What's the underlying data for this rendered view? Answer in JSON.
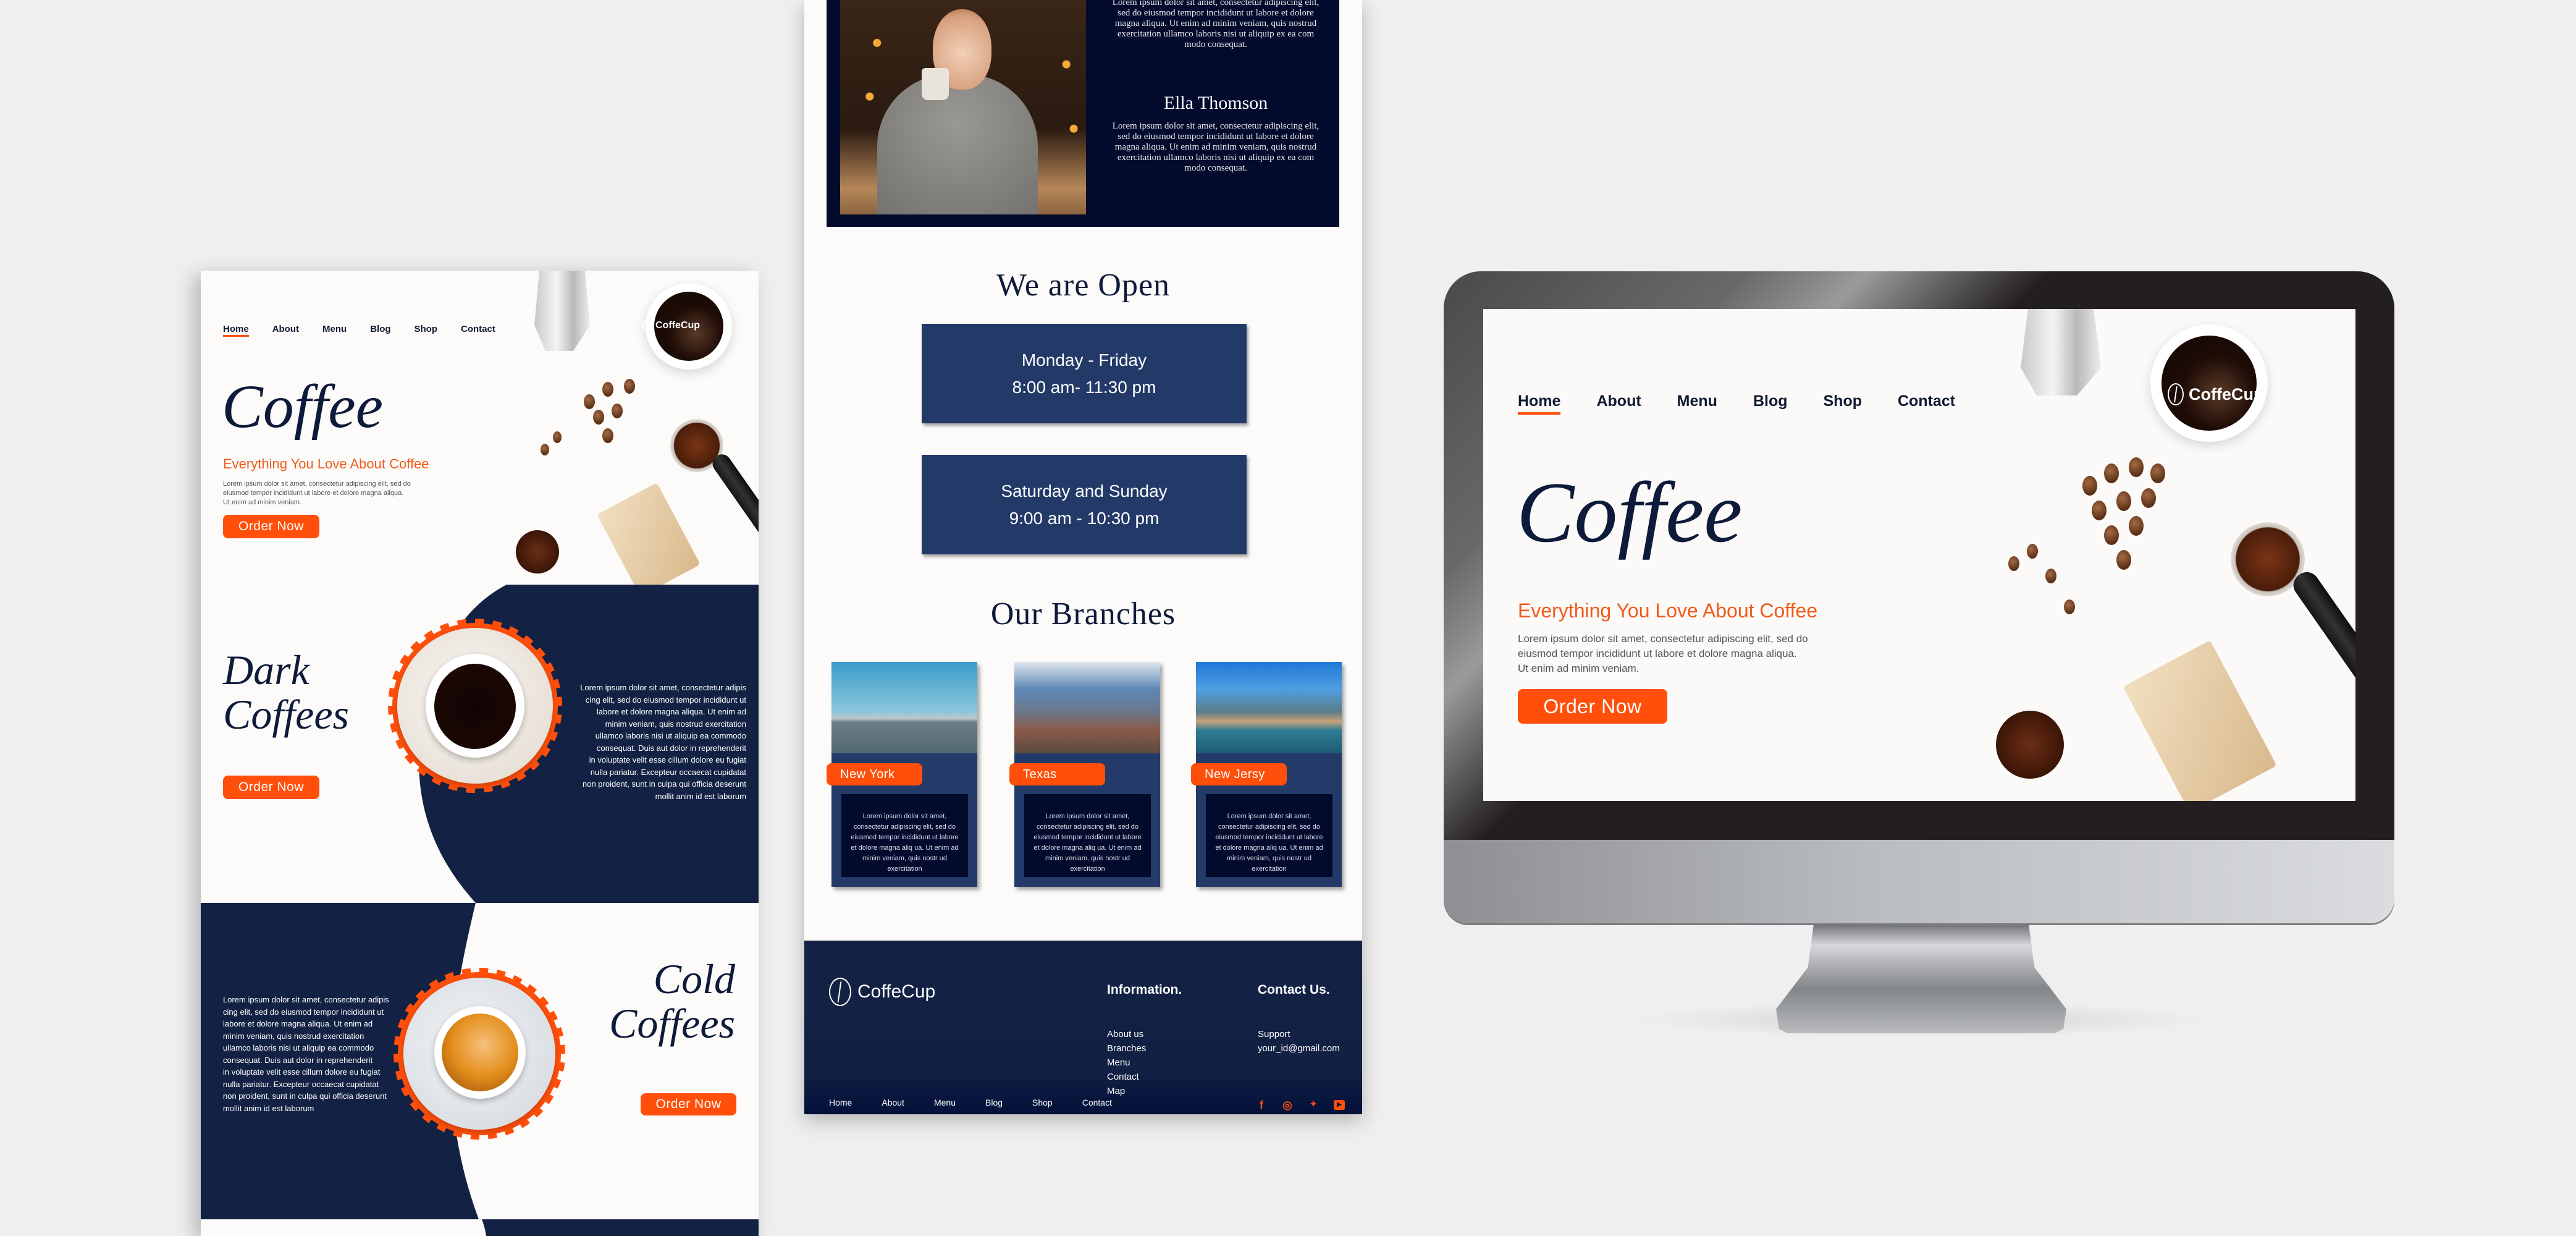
{
  "brand": {
    "name": "CoffeCup",
    "accent_color": "#ff4f0b",
    "navy_color": "#132244",
    "deep_navy_color": "#020b2b",
    "card_blue_color": "#233a68"
  },
  "nav": {
    "items": [
      "Home",
      "About",
      "Menu",
      "Blog",
      "Shop",
      "Contact"
    ],
    "active": "Home"
  },
  "hero": {
    "title": "Coffee",
    "subtitle": "Everything You Love About Coffee",
    "body_lines": [
      "Lorem ipsum dolor sit amet, consectetur adipiscing elit, sed do",
      "eiusmod tempor incididunt ut labore et dolore magna aliqua.",
      "Ut enim ad minim veniam."
    ],
    "cta": "Order Now"
  },
  "dark_coffees": {
    "title_line1": "Dark",
    "title_line2": "Coffees",
    "cta": "Order Now",
    "body_lines": [
      "Lorem ipsum dolor sit amet, consectetur adipis",
      "cing elit, sed do eiusmod tempor incididunt ut",
      "labore et dolore magna aliqua. Ut enim ad",
      "minim veniam, quis nostrud exercitation",
      "ullamco laboris nisi ut aliquip ea commodo",
      "consequat. Duis aut dolor in reprehenderit",
      "in voluptate velit esse cillum dolore eu fugiat",
      "nulla pariatur. Excepteur  occaecat cupidatat",
      "non proident, sunt in culpa qui officia deserunt",
      "mollit anim id est laborum"
    ]
  },
  "cold_coffees": {
    "title_line1": "Cold",
    "title_line2": "Coffees",
    "cta": "Order Now",
    "body_lines": [
      "Lorem ipsum dolor sit amet, consectetur adipis",
      "cing elit, sed do eiusmod tempor incididunt ut",
      "labore et dolore magna aliqua. Ut enim ad",
      "minim veniam, quis nostrud exercitation",
      "ullamco laboris nisi ut aliquip ea commodo",
      "consequat. Duis aut dolor in reprehenderit",
      "in voluptate velit esse cillum dolore eu fugiat",
      "nulla pariatur. Excepteur  occaecat cupidatat",
      " non proident, sunt in culpa qui officia deserunt",
      "mollit anim id est laborum"
    ]
  },
  "testimonial": {
    "top_text_lines": [
      "Lorem ipsum dolor sit amet, consectetur adipiscing elit,",
      "sed do eiusmod tempor incididunt ut labore et dolore",
      "magna aliqua. Ut enim ad minim veniam, quis nostrud",
      "exercitation ullamco laboris nisi ut aliquip ex ea com",
      "modo consequat."
    ],
    "name": "Ella Thomson",
    "text_lines": [
      "Lorem ipsum dolor sit amet, consectetur adipiscing elit,",
      "sed do eiusmod tempor incididunt ut labore et dolore",
      "magna aliqua. Ut enim ad minim veniam, quis nostrud",
      "exercitation ullamco laboris nisi ut aliquip ex ea com",
      "modo consequat."
    ]
  },
  "hours": {
    "title": "We are Open",
    "slots": [
      {
        "days": "Monday - Friday",
        "time": "8:00 am- 11:30 pm"
      },
      {
        "days": "Saturday and Sunday",
        "time": "9:00 am - 10:30 pm"
      }
    ]
  },
  "branches": {
    "title": "Our Branches",
    "items": [
      {
        "name": "New York",
        "text": "Lorem ipsum dolor sit amet, consectetur adipiscing elit, sed do eiusmod tempor incididunt ut labore et dolore magna aliq ua. Ut enim ad minim veniam, quis nostr ud exercitation"
      },
      {
        "name": "Texas",
        "text": "Lorem ipsum dolor sit amet, consectetur adipiscing elit, sed do eiusmod tempor incididunt ut labore et dolore magna aliq ua. Ut enim ad minim veniam, quis nostr ud exercitation"
      },
      {
        "name": "New Jersy",
        "text": "Lorem ipsum dolor sit amet, consectetur adipiscing elit, sed do eiusmod tempor incididunt ut labore et dolore magna aliq ua. Ut enim ad minim veniam, quis nostr ud exercitation"
      }
    ]
  },
  "footer": {
    "info_heading": "Information.",
    "info_links": [
      "About us",
      "Branches",
      "Menu",
      "Contact",
      "Map"
    ],
    "contact_heading": "Contact Us.",
    "contact_lines": [
      "Support",
      "your_id@gmail.com"
    ],
    "bottom_nav": [
      "Home",
      "About",
      "Menu",
      "Blog",
      "Shop",
      "Contact"
    ],
    "socials": [
      {
        "name": "facebook-icon",
        "glyph": "f"
      },
      {
        "name": "instagram-icon",
        "glyph": "◎"
      },
      {
        "name": "twitter-icon",
        "glyph": "🐦"
      },
      {
        "name": "youtube-icon",
        "glyph": "▶"
      }
    ]
  }
}
